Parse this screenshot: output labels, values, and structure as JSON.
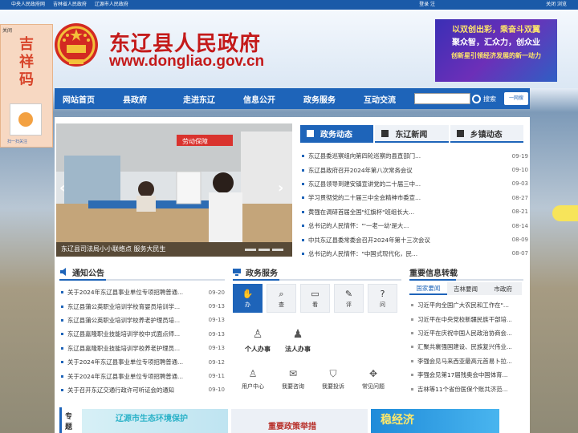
{
  "topbar": {
    "links": [
      "中央人民政府网",
      "吉林省人民政府",
      "辽源市人民政府"
    ],
    "login": "登录 注",
    "right": "关闭 浏览"
  },
  "header": {
    "title": "东辽县人民政府",
    "url": "www.dongliao.gov.cn",
    "ad_lines": [
      "以双创出彩，乘奋斗双翼",
      "聚众智，汇众力，创众业",
      "创新星引领经济发展的新一动力"
    ]
  },
  "left_float": {
    "close": "关闭",
    "mascot": "吉祥码",
    "qr_caption": "扫一扫关注"
  },
  "nav": {
    "items": [
      "网站首页",
      "县政府",
      "走进东辽",
      "信息公开",
      "政务服务",
      "互动交流"
    ],
    "search_placeholder": "",
    "search_label": "搜索",
    "one_search": "一网搜"
  },
  "slide": {
    "caption": "东辽县司法局小小联络点 服务大民生",
    "sign_text": "劳动保障"
  },
  "news": {
    "tabs": [
      "政务动态",
      "东辽新闻",
      "乡镇动态"
    ],
    "items": [
      {
        "title": "东辽县委巡察组向第四轮巡察的县直部门...",
        "date": "09-19"
      },
      {
        "title": "东辽县政府召开2024年第八次常务会议",
        "date": "09-10"
      },
      {
        "title": "东辽县领导到建安镇宣讲党的二十届三中...",
        "date": "09-03"
      },
      {
        "title": "学习贯彻党的二十届三中全会精神市委宣...",
        "date": "08-27"
      },
      {
        "title": "黄强在调研首届全国\"红旗杯\"班组长大...",
        "date": "08-21"
      },
      {
        "title": "总书记的人民情怀：\"'一老一幼'是大...",
        "date": "08-14"
      },
      {
        "title": "中共东辽县委常委会召开2024年第十三次会议",
        "date": "08-09"
      },
      {
        "title": "总书记的人民情怀：\"中国式现代化，民...",
        "date": "08-07"
      }
    ]
  },
  "notice": {
    "heading": "通知公告",
    "items": [
      {
        "title": "关于2024年东辽县事业单位专项招聘普通...",
        "date": "09-20"
      },
      {
        "title": "东辽县蒲公英职业培训学校育婴员培训学...",
        "date": "09-13"
      },
      {
        "title": "东辽县蒲公英职业培训学校养老护理员培...",
        "date": "09-13"
      },
      {
        "title": "东辽县嘉隆职业技能培训学校中式面点师...",
        "date": "09-13"
      },
      {
        "title": "东辽县嘉隆职业技能培训学校养老护理员...",
        "date": "09-13"
      },
      {
        "title": "关于2024年东辽县事业单位专项招聘普通...",
        "date": "09-12"
      },
      {
        "title": "关于2024年东辽县事业单位专项招聘普通...",
        "date": "09-11"
      },
      {
        "title": "关于召开东辽交通行政许可听证会的通知",
        "date": "09-10"
      }
    ]
  },
  "services": {
    "heading": "政务服务",
    "top": [
      {
        "label": "办",
        "glyph": "✋"
      },
      {
        "label": "查",
        "glyph": "⌕"
      },
      {
        "label": "看",
        "glyph": "▭"
      },
      {
        "label": "评",
        "glyph": "✎"
      },
      {
        "label": "问",
        "glyph": "?"
      }
    ],
    "mid": [
      {
        "label": "个人办事",
        "glyph": "♙"
      },
      {
        "label": "法人办事",
        "glyph": "♟"
      }
    ],
    "bottom": [
      {
        "label": "用户中心",
        "glyph": "♙"
      },
      {
        "label": "我要咨询",
        "glyph": "✉"
      },
      {
        "label": "我要投诉",
        "glyph": "⛉"
      },
      {
        "label": "常见问题",
        "glyph": "✥"
      }
    ]
  },
  "key_info": {
    "heading": "重要信息转载",
    "tabs": [
      "国家要闻",
      "吉林要闻",
      "市政府"
    ],
    "items": [
      "习近平向全国广大农民和工作在\"...",
      "习近平在中央党校新疆民族干部培...",
      "习近平在庆祝中国人民政治协商会...",
      "汇聚共襄强国建设、民族复兴伟业...",
      "李强会见马来西亚最高元首易卜拉...",
      "李强会见第17届残奥会中国体育...",
      "吉林等11个省份医保个账共济范..."
    ]
  },
  "special": {
    "label": "专题",
    "items": [
      "辽源市生态环境保护",
      "重要政策举措",
      "稳经济"
    ]
  },
  "colors": {
    "primary": "#1e64b9",
    "title_red": "#c41a1a",
    "topbar": "#1a5aa8"
  }
}
